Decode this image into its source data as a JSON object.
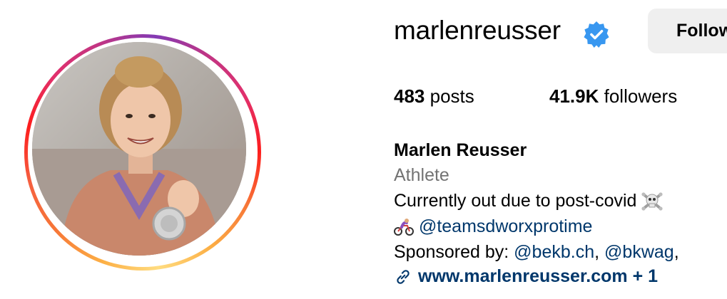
{
  "profile": {
    "username": "marlenreusser",
    "full_name": "Marlen Reusser",
    "category": "Athlete",
    "follow_label": "Follow",
    "stats": {
      "posts_count": "483",
      "posts_label": "posts",
      "followers_count": "41.9K",
      "followers_label": "followers"
    },
    "bio": {
      "line1_text": "Currently out due to post-covid",
      "line1_emoji": "skull-crossbones",
      "line2_emoji": "person-biking",
      "line2_mention": "@teamsdworxprotime",
      "line3_prefix": "Sponsored by: ",
      "line3_mention1": "@bekb.ch",
      "line3_sep": ", ",
      "line3_mention2": "@bkwag",
      "line3_trailing": ", ",
      "link_text": "www.marlenreusser.com + 1"
    }
  },
  "icons": {
    "verified": "verified-badge-icon",
    "link": "link-icon"
  },
  "colors": {
    "verified_blue": "#3897f0",
    "link_blue": "#00376b",
    "category_gray": "#737373",
    "button_bg": "#efefef"
  }
}
